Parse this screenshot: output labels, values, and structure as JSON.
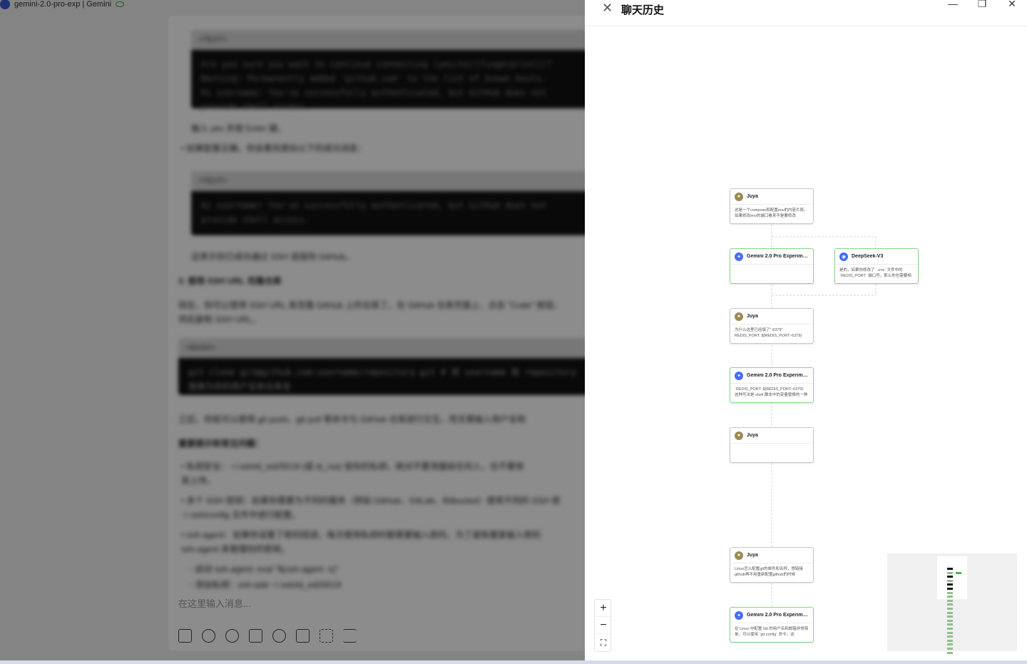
{
  "background": {
    "window_title": "gemini-2.0-pro-exp | Gemini",
    "composer_placeholder": "在这里输入消息...",
    "code_blocks": [
      {
        "lang": "<TEXT>",
        "lines": [
          "Are you sure you want to continue connecting (yes/no/[fingerprint])?",
          "Warning: Permanently added 'github.com' to the list of known hosts.",
          "Hi username! You've successfully authenticated, but GitHub does not provide shell access."
        ]
      },
      {
        "lang": "<TEXT>",
        "lines": [
          "Hi username! You've successfully authenticated, but GitHub does not provide shell access."
        ]
      },
      {
        "lang": "<BASH>",
        "lines": [
          "git clone git@github.com:username/repository.git  # 将 username 和 repository",
          "替换为你的用户名和仓库名"
        ]
      }
    ],
    "paragraphs": [
      "输入 yes 并按 Enter 键。",
      "• 如果配置正确，你会看到类似以下的成功消息：",
      "这表示你已成功通过 SSH 连接到 GitHub。",
      "3. 使用 SSH URL 克隆仓库",
      "现在，你可以使用 SSH URL 来克隆 GitHub 上的仓库了。在 GitHub 仓库页面上，点击 \"Code\" 按钮，",
      "然后复制 SSH URL。",
      "之后，你就可以使用 git push、git pull 等命令与 GitHub 仓库进行交互，而无需输入用户名和",
      "重要提示和常见问题：",
      "• 私钥安全：~/.ssh/id_ed25519 (或 id_rsa) 是你的私钥，绝对不要泄露给任何人，也不要将",
      "   其上传。",
      "• 多个 SSH 密钥：如果你需要为不同的服务（例如 GitHub、GitLab、Bitbucket）使用不同的 SSH 密",
      "   ~/.ssh/config 文件中进行配置。",
      "• ssh-agent：如果你设置了密码短语，每次使用私钥时都需要输入密码。为了避免重复输入密码",
      "   ssh-agent 来管理你的密钥。",
      "   ◦ 启动 ssh-agent: eval \"$(ssh-agent -s)\"",
      "   ◦ 添加私钥：ssh-add ~/.ssh/id_ed25519"
    ],
    "composer_tools": [
      "new-chat-icon",
      "attach-icon",
      "web-icon",
      "doc-icon",
      "mention-icon",
      "toolbox-icon",
      "expand-icon",
      "menu-icon"
    ]
  },
  "panel": {
    "title": "聊天历史",
    "close_icon": "close-icon",
    "window_controls": [
      "minimize-icon",
      "restore-icon",
      "close-window-icon"
    ],
    "nodes": [
      {
        "role": "user",
        "name": "Juya",
        "text": "这是一个compose和配置env的内容片段，如果修改env的端口看来不是要修改"
      },
      {
        "role": "gemini",
        "name": "Gemini 2.0 Pro Experimen...",
        "text": ""
      },
      {
        "role": "deepseek",
        "name": "DeepSeek-V3",
        "text": "是的，如果你修改了 `.env` 文件中的 `REDIS_PORT` 端口号，那么你也需要相"
      },
      {
        "role": "user",
        "name": "Juya",
        "text": "为什么这里已经填了\"-6379\" REDIS_PORT: ${REDIS_PORT:-6379}"
      },
      {
        "role": "gemini",
        "name": "Gemini 2.0 Pro Experimen...",
        "text": "`REDIS_PORT: ${REDIS_PORT:-6379}` 这种写法是 shell 脚本中的变量替换的一种"
      },
      {
        "role": "user",
        "name": "Juya",
        "text": ""
      },
      {
        "role": "user",
        "name": "Juya",
        "text": "Linux怎么配置git的邮件和名称，想链接github再不用重新配置github的时候"
      },
      {
        "role": "gemini",
        "name": "Gemini 2.0 Pro Experimen...",
        "text": "在 Linux 中配置 Git 的用户名和邮箱非常简单，可以使用 `git config` 命令。这"
      }
    ],
    "zoom_controls": {
      "zoom_in": "+",
      "zoom_out": "−",
      "fit": "⛶"
    },
    "minimap_colors": {
      "user": "#111111",
      "ai": "#8fbf8f",
      "branch": "#4caf50"
    }
  }
}
